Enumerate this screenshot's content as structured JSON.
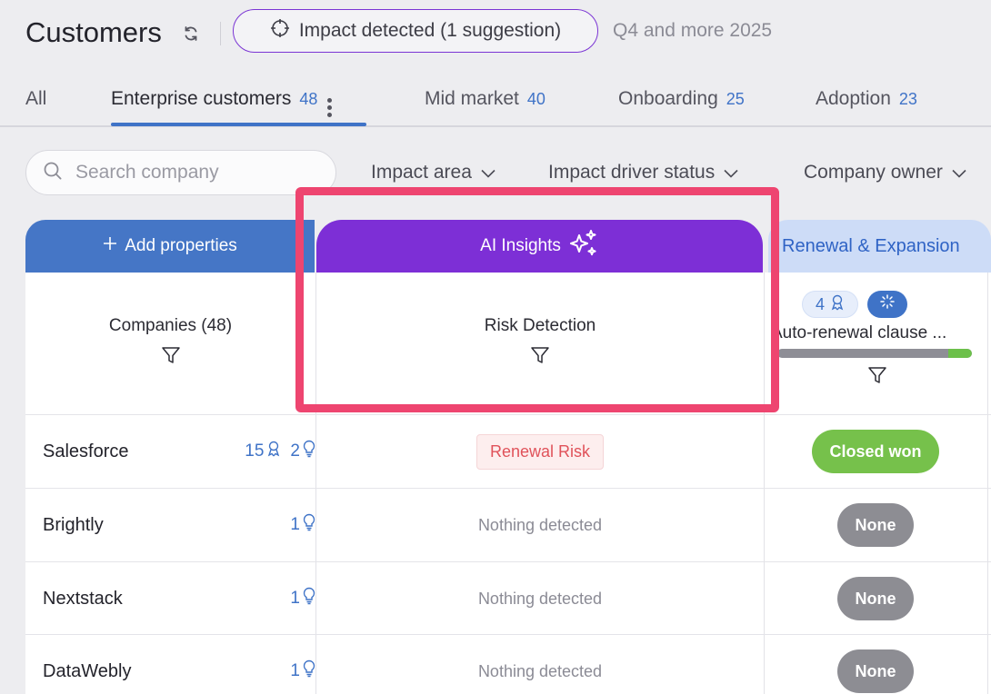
{
  "header": {
    "title": "Customers",
    "impact_pill": "Impact detected (1 suggestion)",
    "period": "Q4 and more 2025"
  },
  "tabs": [
    {
      "label": "All",
      "count": ""
    },
    {
      "label": "Enterprise customers",
      "count": "48"
    },
    {
      "label": "Mid market",
      "count": "40"
    },
    {
      "label": "Onboarding",
      "count": "25"
    },
    {
      "label": "Adoption",
      "count": "23"
    }
  ],
  "search": {
    "placeholder": "Search company"
  },
  "filters": [
    "Impact area",
    "Impact driver status",
    "Company owner"
  ],
  "columns": {
    "add_properties": "Add properties",
    "ai_insights": "AI Insights",
    "renewal": "Renewal & Expansion",
    "companies": "Companies (48)",
    "risk_detection": "Risk Detection",
    "auto_renewal": "Auto-renewal clause ...",
    "auto_renewal_badge_count": "4",
    "auto_renewal_progress": 0.12
  },
  "rows": [
    {
      "name": "Salesforce",
      "count_a": "15",
      "count_b": "2",
      "risk": "Renewal Risk",
      "status": "Closed won"
    },
    {
      "name": "Brightly",
      "count_a": "",
      "count_b": "1",
      "risk": "Nothing detected",
      "status": "None"
    },
    {
      "name": "Nextstack",
      "count_a": "",
      "count_b": "1",
      "risk": "Nothing detected",
      "status": "None"
    },
    {
      "name": "DataWebly",
      "count_a": "",
      "count_b": "1",
      "risk": "Nothing detected",
      "status": "None"
    }
  ],
  "colors": {
    "accent_blue": "#3f73c7",
    "ai_purple": "#7d2fd6",
    "highlight": "#ee4570",
    "won_green": "#76c14b",
    "none_gray": "#8d8d93"
  }
}
